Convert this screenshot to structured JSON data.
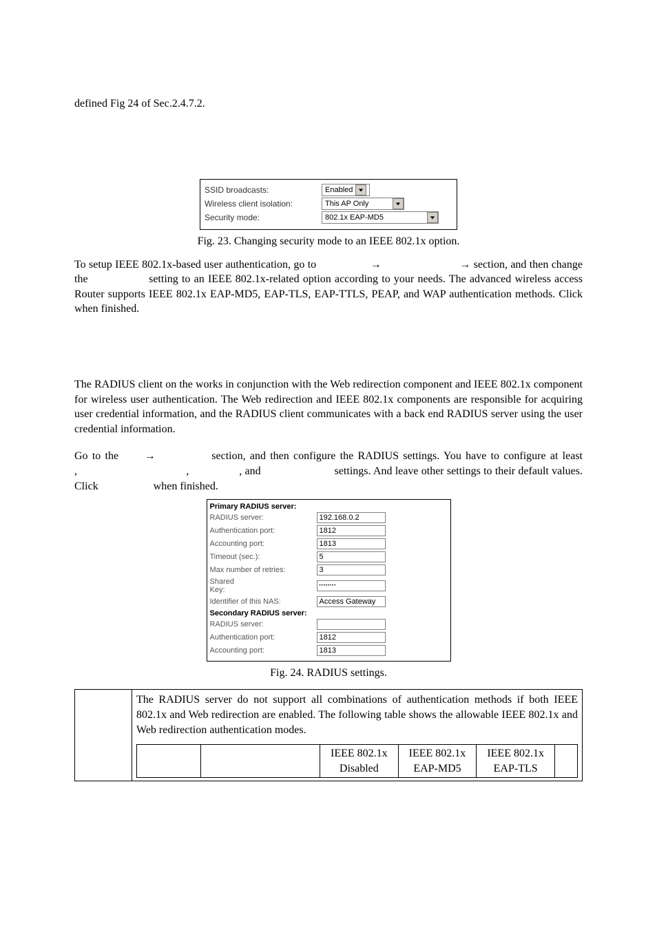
{
  "intro_line": "defined Fig 24 of Sec.2.4.7.2.",
  "fig23": {
    "rows": {
      "ssid_label": "SSID broadcasts:",
      "ssid_value": "Enabled",
      "wci_label": "Wireless client isolation:",
      "wci_value": "This AP Only",
      "sec_label": "Security mode:",
      "sec_value": "802.1x EAP-MD5"
    },
    "caption": "Fig. 23. Changing security mode to an IEEE 802.1x option."
  },
  "para1": "To setup IEEE 802.1x-based user authentication, go to                  →                          → section, and then change the                 setting to an IEEE 802.1x-related option according to your needs. The advanced wireless access Router supports IEEE 802.1x EAP-MD5, EAP-TLS, EAP-TTLS, PEAP, and WAP authentication methods. Click        when finished.",
  "para2": "The RADIUS client on the                   works in conjunction with the Web redirection component and IEEE 802.1x component for wireless user authentication. The Web redirection and IEEE 802.1x components are responsible for acquiring user credential information, and the RADIUS client communicates with a back end RADIUS server using the user credential information.",
  "para3": "Go to the      →             section, and then configure the RADIUS settings. You have to configure at least                       ,                                     ,                 , and                         settings. And leave other settings to their default values. Click                    when finished.",
  "fig24": {
    "primary_head": "Primary RADIUS server:",
    "rows": {
      "p_server_label": "RADIUS server:",
      "p_server_value": "192.168.0.2",
      "p_auth_label": "Authentication port:",
      "p_auth_value": "1812",
      "p_acct_label": "Accounting port:",
      "p_acct_value": "1813",
      "p_timeout_label": "Timeout (sec.):",
      "p_timeout_value": "5",
      "p_retries_label": "Max number of retries:",
      "p_retries_value": "3",
      "p_shared_label": "Shared Key:",
      "p_shared_value": "••••••••",
      "p_nas_label": "Identifier of this NAS:",
      "p_nas_value": "Access Gateway"
    },
    "secondary_head": "Secondary RADIUS server:",
    "secondary": {
      "s_server_label": "RADIUS server:",
      "s_server_value": "",
      "s_auth_label": "Authentication port:",
      "s_auth_value": "1812",
      "s_acct_label": "Accounting port:",
      "s_acct_value": "1813"
    },
    "caption": "Fig. 24. RADIUS settings."
  },
  "note": {
    "text": "The RADIUS server do not support all combinations of authentication methods if both IEEE 802.1x and Web redirection are enabled. The following table shows the allowable IEEE 802.1x and Web redirection authentication modes.",
    "table_headers": {
      "blank1": "",
      "blank2": "",
      "c1_l1": "IEEE 802.1x",
      "c1_l2": "Disabled",
      "c2_l1": "IEEE 802.1x",
      "c2_l2": "EAP-MD5",
      "c3_l1": "IEEE 802.1x",
      "c3_l2": "EAP-TLS"
    }
  }
}
